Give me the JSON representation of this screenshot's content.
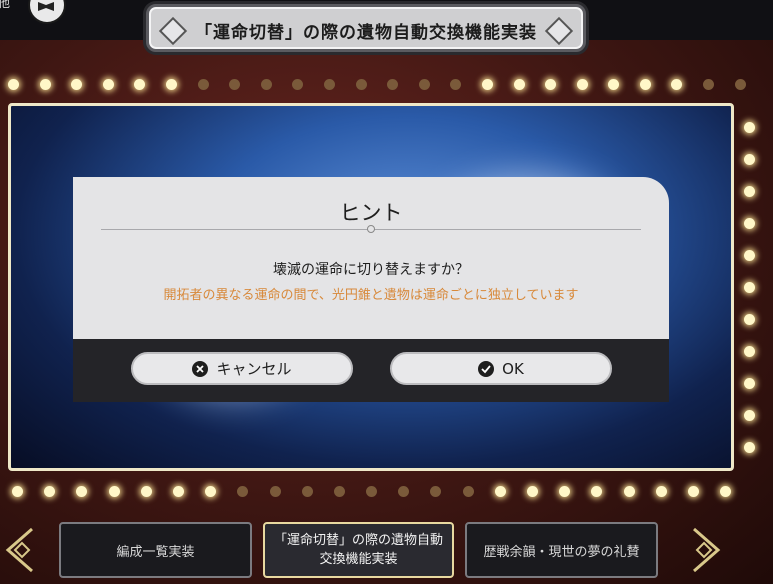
{
  "header": {
    "corner_label": "他",
    "title": "「運命切替」の際の遺物自動交換機能実装"
  },
  "dialog": {
    "title": "ヒント",
    "message": "壊滅の運命に切り替えますか？",
    "note": "開拓者の異なる運命の間で、光円錐と遺物は運命ごとに独立しています",
    "cancel_label": "キャンセル",
    "ok_label": "OK"
  },
  "bottom_nav": {
    "tabs": [
      {
        "label": "編成一覧実装"
      },
      {
        "label": "「運命切替」の際の遺物自動交換機能実装"
      },
      {
        "label": "歴戦余韻・現世の夢の礼賛"
      }
    ]
  },
  "colors": {
    "note_text": "#d8893a",
    "dialog_bg": "#e4e4e6",
    "dialog_footer": "#242428",
    "screen_blue": "#2a5aa8"
  }
}
